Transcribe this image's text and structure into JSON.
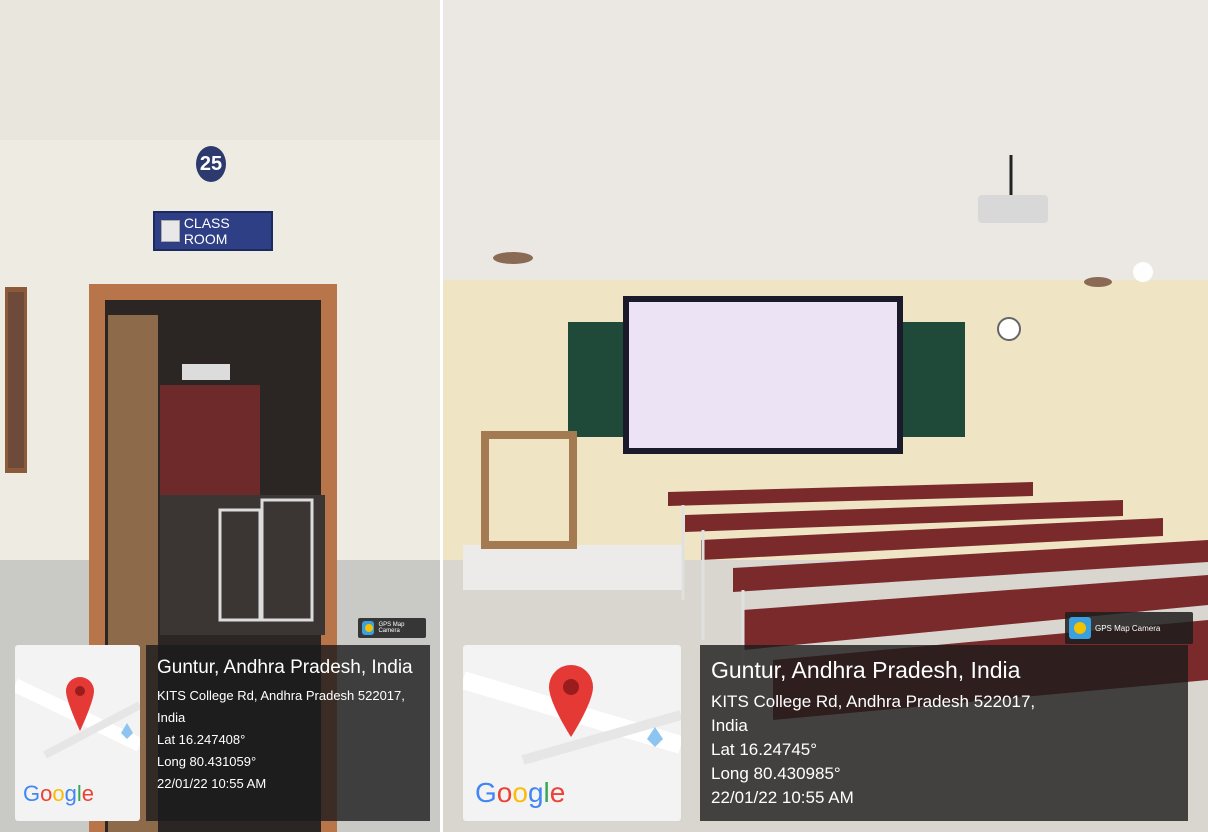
{
  "left_photo": {
    "room_number": "25",
    "room_sign": "CLASS ROOM",
    "badge": "GPS Map Camera",
    "google_logo": "Google",
    "location": {
      "title": "Guntur, Andhra Pradesh, India",
      "address_line1": "KITS College Rd, Andhra Pradesh 522017,",
      "address_line2": "India",
      "lat": "Lat 16.247408°",
      "long": "Long 80.431059°",
      "datetime": "22/01/22 10:55 AM"
    }
  },
  "right_photo": {
    "badge": "GPS Map Camera",
    "google_logo": "Google",
    "location": {
      "title": "Guntur, Andhra Pradesh, India",
      "address_line1": "KITS College Rd, Andhra Pradesh 522017,",
      "address_line2": "India",
      "lat": "Lat 16.24745°",
      "long": "Long 80.430985°",
      "datetime": "22/01/22 10:55 AM"
    }
  },
  "colors": {
    "info_panel_bg": "#1c1c1c",
    "map_pin": "#e53935",
    "sign_blue": "#2f3f86",
    "wall": "#f0ebde",
    "screen": "#ece4f4",
    "board": "#1f4a3a",
    "desk": "#7a2a2a"
  },
  "icons": [
    "map-pin-icon",
    "gps-camera-icon",
    "google-logo"
  ]
}
